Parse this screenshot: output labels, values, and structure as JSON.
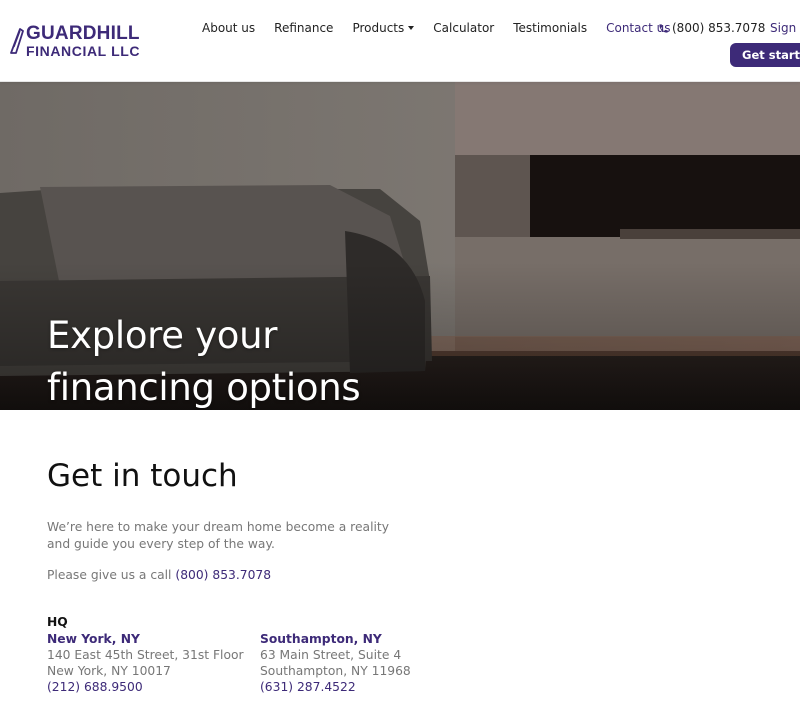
{
  "brand": {
    "name_line1": "GUARDHILL",
    "name_line2": "FINANCIAL LLC",
    "colors": {
      "primary": "#3d2a78",
      "text": "#222222",
      "muted": "#777777"
    }
  },
  "nav": {
    "items": [
      {
        "label": "About us"
      },
      {
        "label": "Refinance"
      },
      {
        "label": "Products",
        "has_dropdown": true
      },
      {
        "label": "Calculator"
      },
      {
        "label": "Testimonials"
      },
      {
        "label": "Contact us",
        "active": true
      }
    ],
    "phone": "(800) 853.7078",
    "sign_in": "Sign in",
    "get_started": "Get started"
  },
  "hero": {
    "title_line1": "Explore your",
    "title_line2": "financing options"
  },
  "contact": {
    "title": "Get in touch",
    "intro": "We’re here to make your dream home become a reality and guide you every step of the way.",
    "call_prefix": "Please give us a call ",
    "call_phone": "(800) 853.7078",
    "hq_label": "HQ",
    "offices": [
      {
        "city": "New York, NY",
        "address1": "140 East 45th Street, 31st Floor",
        "address2": "New York, NY 10017",
        "phone": "(212) 688.9500"
      },
      {
        "city": "Southampton, NY",
        "address1": "63 Main Street, Suite 4",
        "address2": "Southampton, NY 11968",
        "phone": "(631) 287.4522"
      }
    ]
  }
}
